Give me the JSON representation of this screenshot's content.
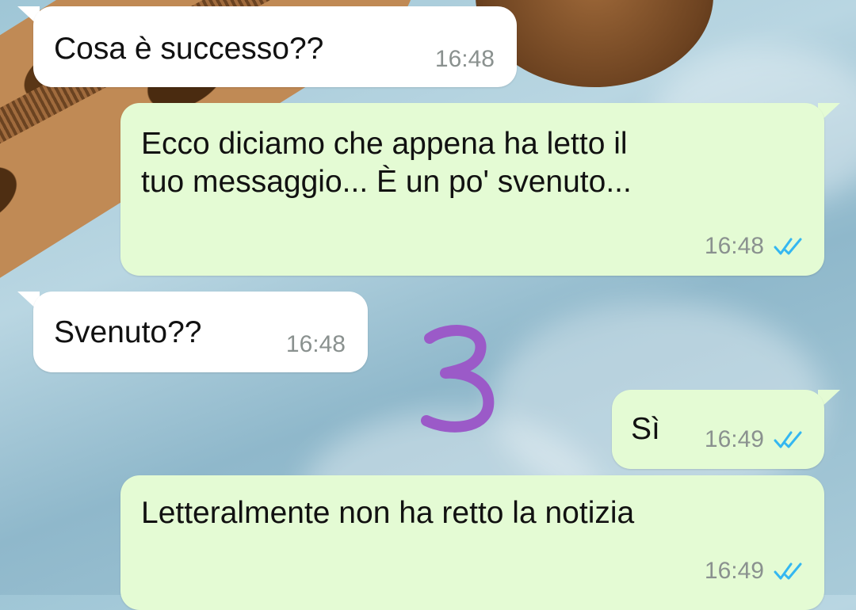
{
  "messages": [
    {
      "text": "Cosa è successo??",
      "time": "16:48",
      "direction": "incoming"
    },
    {
      "text": "Ecco diciamo che appena ha letto il\ntuo messaggio... È un po' svenuto...",
      "time": "16:48",
      "direction": "outgoing",
      "status": "read"
    },
    {
      "text": "Svenuto??",
      "time": "16:48",
      "direction": "incoming"
    },
    {
      "text": "Sì",
      "time": "16:49",
      "direction": "outgoing",
      "status": "read"
    },
    {
      "text": "Letteralmente non ha retto la notizia",
      "time": "16:49",
      "direction": "outgoing",
      "status": "read"
    }
  ],
  "overlay_mark": {
    "text": "3",
    "color": "#9b5ac8"
  },
  "colors": {
    "incoming_bubble": "#ffffff",
    "outgoing_bubble": "#e4fbd4",
    "read_tick": "#34b7f1",
    "timestamp": "#8a918f"
  },
  "icons": {
    "read_receipt": "double-check-icon"
  }
}
